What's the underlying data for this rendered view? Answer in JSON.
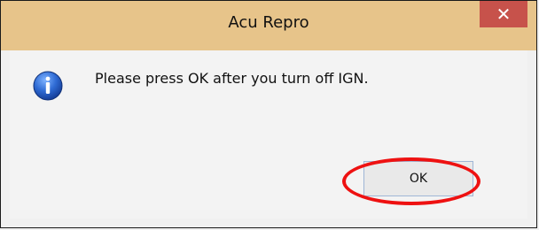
{
  "window": {
    "title": "Acu Repro",
    "close_glyph": "✕",
    "icon": "info-icon",
    "message": "Please press OK after you turn off IGN.",
    "ok_label": "OK",
    "highlight_color": "#e01b1b",
    "titlebar_color": "#e7c48a",
    "close_color": "#c7524b"
  }
}
